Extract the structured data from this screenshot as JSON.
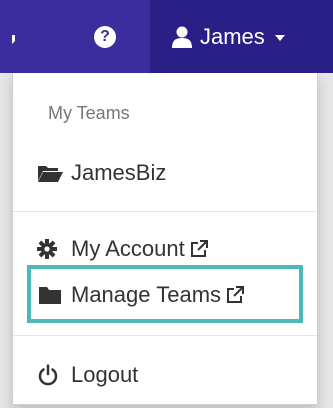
{
  "navbar": {
    "help_symbol": "?",
    "user_name": "James"
  },
  "dropdown": {
    "section_header": "My Teams",
    "team_item": {
      "label": "JamesBiz",
      "icon": "folder-open-icon"
    },
    "account_item": {
      "label": "My Account",
      "icon": "gear-icon",
      "external_icon": "external-link-icon"
    },
    "manage_teams_item": {
      "label": "Manage Teams",
      "icon": "folder-icon",
      "external_icon": "external-link-icon"
    },
    "logout_item": {
      "label": "Logout",
      "icon": "power-icon"
    }
  },
  "colors": {
    "navbar_bg": "#3c2d9e",
    "navbar_active_bg": "#2a1f86",
    "highlight": "#4cb8b8"
  }
}
